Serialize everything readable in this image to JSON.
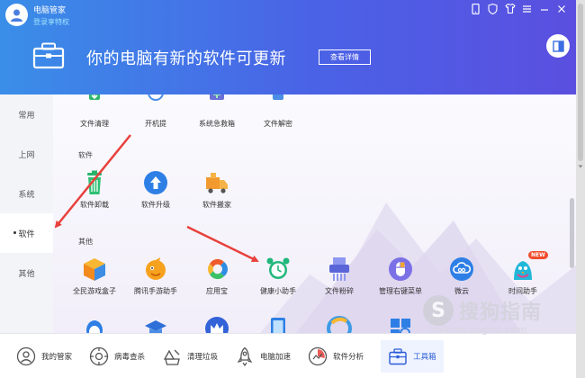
{
  "window": {
    "title": "电脑管家",
    "login_link": "登录享特权"
  },
  "banner": {
    "headline": "你的电脑有新的软件可更新",
    "detail_button": "查看详情"
  },
  "sidebar": {
    "items": [
      {
        "label": "常用"
      },
      {
        "label": "上网"
      },
      {
        "label": "系统"
      },
      {
        "label": "软件",
        "active": true
      },
      {
        "label": "其他"
      }
    ]
  },
  "sections": {
    "top_row": [
      {
        "label": "文件清理",
        "icon": "file-clean-icon"
      },
      {
        "label": "开机提",
        "icon": "boot-speed-icon"
      },
      {
        "label": "系统急救箱",
        "icon": "first-aid-icon"
      },
      {
        "label": "文件解密",
        "icon": "file-decrypt-icon"
      }
    ],
    "software_title": "软件",
    "software_items": [
      {
        "label": "软件卸载",
        "icon": "uninstall-icon"
      },
      {
        "label": "软件升级",
        "icon": "upgrade-icon"
      },
      {
        "label": "软件搬家",
        "icon": "move-truck-icon"
      }
    ],
    "other_title": "其他",
    "other_items": [
      {
        "label": "全民游戏盒子",
        "icon": "game-box-icon"
      },
      {
        "label": "腾讯手游助手",
        "icon": "mobile-game-icon"
      },
      {
        "label": "应用宝",
        "icon": "app-store-icon"
      },
      {
        "label": "健康小助手",
        "icon": "alarm-clock-icon"
      },
      {
        "label": "文件粉碎",
        "icon": "shredder-icon"
      },
      {
        "label": "管理右键菜单",
        "icon": "mouse-icon"
      },
      {
        "label": "微云",
        "icon": "cloud-icon"
      },
      {
        "label": "时间助手",
        "icon": "bird-icon",
        "badge": "NEW"
      }
    ]
  },
  "bottom_nav": [
    {
      "label": "我的管家",
      "icon": "butler-icon"
    },
    {
      "label": "病毒查杀",
      "icon": "virus-scan-icon"
    },
    {
      "label": "清理垃圾",
      "icon": "trash-icon"
    },
    {
      "label": "电脑加速",
      "icon": "rocket-icon"
    },
    {
      "label": "软件分析",
      "icon": "analysis-icon"
    },
    {
      "label": "工具箱",
      "icon": "toolbox-icon",
      "active": true
    }
  ],
  "watermark": {
    "text": "搜狗指南",
    "url": "zhinan.sogou.com"
  },
  "colors": {
    "header_start": "#3a8ee8",
    "header_end": "#5b4fe0",
    "annotation_arrow": "#e8413c",
    "active_accent": "#2a5bd7"
  }
}
